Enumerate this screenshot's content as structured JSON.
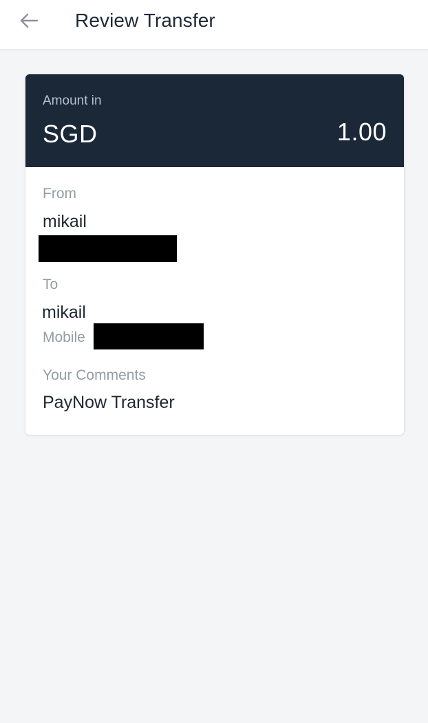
{
  "header": {
    "title": "Review Transfer",
    "back_icon": "back-arrow-icon"
  },
  "summary": {
    "amount_caption": "Amount in",
    "currency": "SGD",
    "amount": "1.00"
  },
  "from": {
    "label": "From",
    "name": "mikail"
  },
  "to": {
    "label": "To",
    "name": "mikail",
    "mobile_label": "Mobile"
  },
  "comments": {
    "label": "Your Comments",
    "value": "PayNow Transfer"
  },
  "colors": {
    "header_bg": "#1b2838",
    "page_bg": "#f4f5f7",
    "card_bg": "#ffffff",
    "text_primary": "#1f2731",
    "text_secondary": "#959ca4"
  }
}
